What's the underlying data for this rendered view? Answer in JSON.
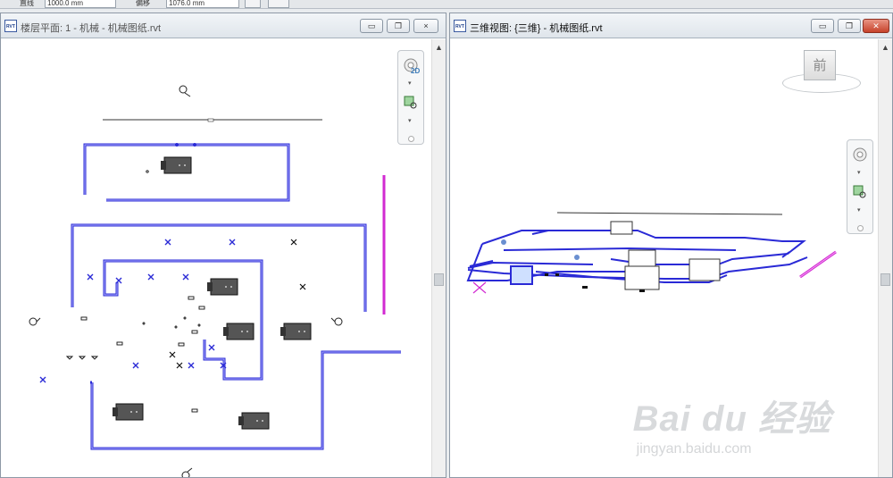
{
  "toolbar": {
    "label_a": "直线",
    "field_a": "1000.0 mm",
    "label_b": "偏移",
    "field_b": "1076.0 mm"
  },
  "left_pane": {
    "title": "楼层平面: 1 - 机械 - 机械图纸.rvt",
    "minimize": "▭",
    "restore": "❐",
    "close": "×",
    "navbar_label": "2D"
  },
  "right_pane": {
    "title": "三维视图: {三维} - 机械图纸.rvt",
    "minimize": "▭",
    "restore": "❐",
    "close": "✕",
    "viewcube_face": "前"
  },
  "icons": {
    "app": "rvt-file-icon",
    "steering": "steering-wheel-icon",
    "zoom": "zoom-region-icon"
  },
  "colors": {
    "duct": "#2a2ad6",
    "pipe_magenta": "#d22ad2",
    "equipment": "#444444",
    "close_button": "#c6422a"
  },
  "watermark": {
    "main": "Bai du 经验",
    "sub": "jingyan.baidu.com"
  }
}
